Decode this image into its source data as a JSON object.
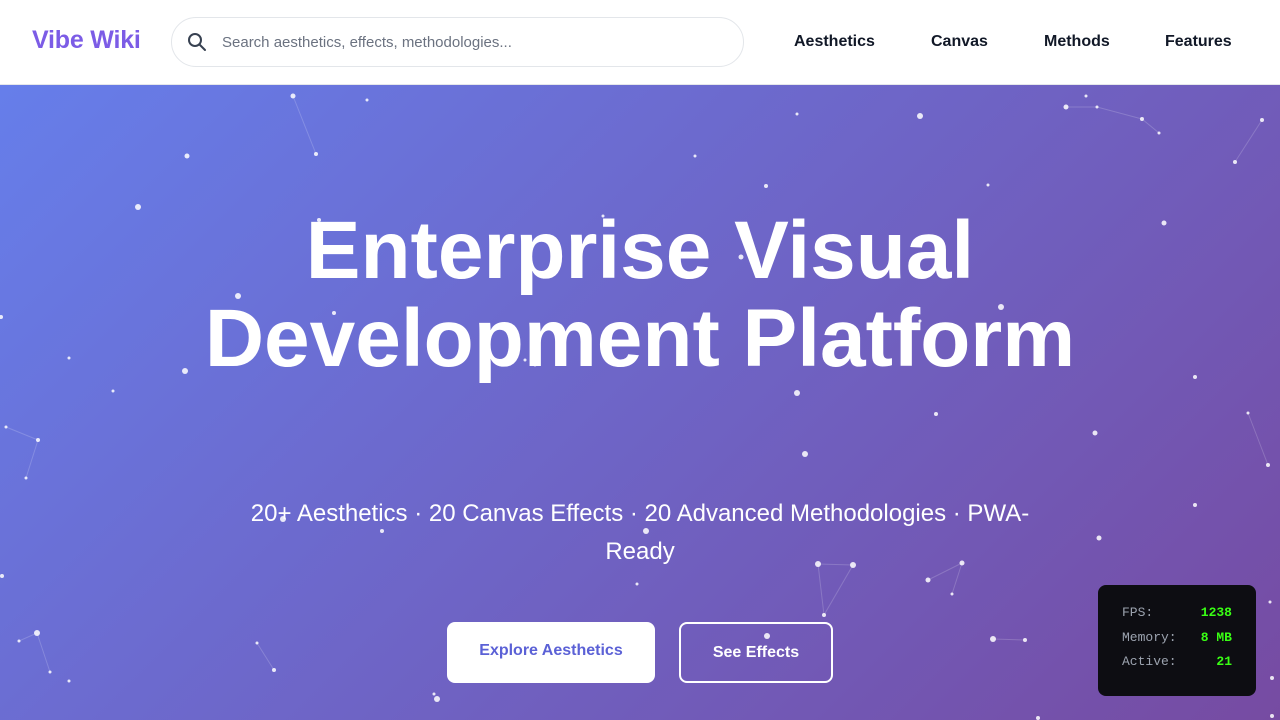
{
  "header": {
    "logo": "Vibe Wiki",
    "search_placeholder": "Search aesthetics, effects, methodologies...",
    "search_value": "",
    "nav": [
      "Aesthetics",
      "Canvas",
      "Methods",
      "Features"
    ]
  },
  "hero": {
    "title": "Enterprise Visual Development Platform",
    "subtitle": "20+ Aesthetics · 20 Canvas Effects · 20 Advanced Methodologies · PWA-Ready",
    "primary_button": "Explore Aesthetics",
    "secondary_button": "See Effects",
    "gradient": [
      "#667eea",
      "#764ba2"
    ]
  },
  "perf_monitor": {
    "fps_label": "FPS:",
    "fps_value": "1238",
    "memory_label": "Memory:",
    "memory_value": "8 MB",
    "active_label": "Active:",
    "active_value": "21"
  },
  "colors": {
    "logo": "#7c5ce6",
    "primary_button_text": "#5b61d6",
    "monitor_value": "#39ff14"
  },
  "icons": [
    "search-icon"
  ]
}
